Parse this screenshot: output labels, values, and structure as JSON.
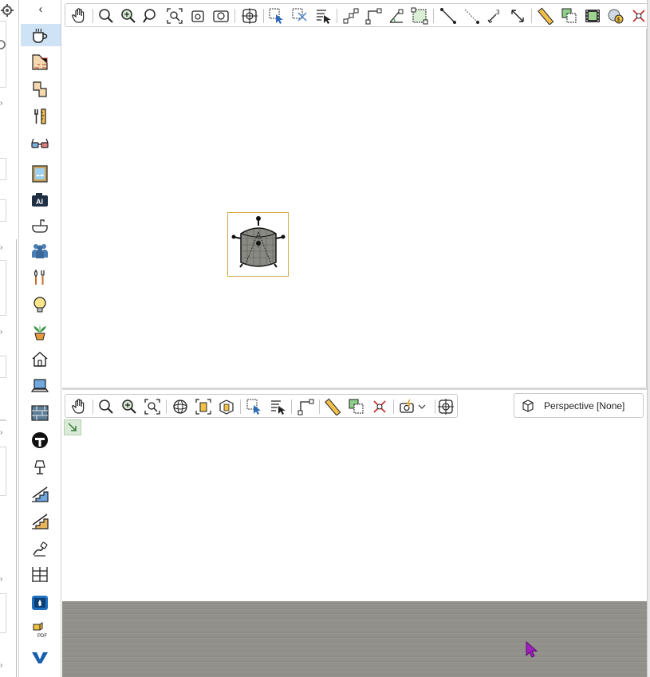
{
  "colors": {
    "selection_highlight": "#cfe3f6",
    "object_selection_border": "#d4a94a",
    "floor": "#918f8a",
    "cursor": "#a020c0"
  },
  "left_panel": {
    "icons": [
      "gear-icon",
      "collapse-arrow-icon"
    ]
  },
  "category_toolbar": {
    "collapse_icon": "chevron-left-icon",
    "collapse_glyph": "‹",
    "items": [
      {
        "name": "kitchen-appliances",
        "icon": "cup-icon"
      },
      {
        "name": "walls",
        "icon": "wall-icon"
      },
      {
        "name": "rooms",
        "icon": "room-icon"
      },
      {
        "name": "tools",
        "icon": "wrench-icon"
      },
      {
        "name": "3d-view",
        "icon": "glasses-icon"
      },
      {
        "name": "pictures",
        "icon": "picture-icon"
      },
      {
        "name": "ai-camera",
        "icon": "ai-camera-icon"
      },
      {
        "name": "bathroom",
        "icon": "sink-icon"
      },
      {
        "name": "people",
        "icon": "people-icon"
      },
      {
        "name": "kitchen-utensils",
        "icon": "utensils-icon"
      },
      {
        "name": "lighting",
        "icon": "light-bulb-icon"
      },
      {
        "name": "plants",
        "icon": "plant-icon"
      },
      {
        "name": "house",
        "icon": "house-icon"
      },
      {
        "name": "computers",
        "icon": "laptop-icon"
      },
      {
        "name": "materials",
        "icon": "texture-icon"
      },
      {
        "name": "brand",
        "icon": "brand-logo-icon"
      },
      {
        "name": "lamps",
        "icon": "lamp-icon"
      },
      {
        "name": "stairs-blue",
        "icon": "stairs-icon"
      },
      {
        "name": "stairs-wood",
        "icon": "stairs-wood-icon"
      },
      {
        "name": "electrical",
        "icon": "plug-icon"
      },
      {
        "name": "shelving",
        "icon": "shelf-icon"
      },
      {
        "name": "fireplace",
        "icon": "fireplace-icon"
      },
      {
        "name": "pdf-import",
        "icon": "pdf-icon"
      },
      {
        "name": "vectorworks",
        "icon": "v-logo-icon"
      }
    ],
    "pdf_label": "PDF"
  },
  "top_toolbar": {
    "buttons": [
      "pan-icon",
      "zoom-icon",
      "zoom-in-icon",
      "zoom-out-icon",
      "zoom-fit-icon",
      "zoom-page-icon",
      "zoom-window-icon",
      "center-icon",
      "select-icon",
      "select-remove-icon",
      "select-properties-icon",
      "snap-points-icon",
      "snap-corner-icon",
      "snap-angle-icon",
      "snap-grid-icon",
      "line-icon",
      "dimension-icon",
      "power-icon",
      "measure-arrow-icon",
      "ruler-icon",
      "copy-icon",
      "film-icon",
      "coin-icon",
      "delete-icon"
    ]
  },
  "view3d_toolbar": {
    "buttons": [
      "pan-icon",
      "zoom-icon",
      "zoom-in-icon",
      "zoom-fit-icon",
      "orbit-icon",
      "walls-icon",
      "box-icon",
      "select-icon",
      "select-properties-icon",
      "snap-corner-icon",
      "ruler-icon",
      "copy-icon",
      "delete-icon",
      "camera-icon",
      "dropdown-icon",
      "center-icon"
    ],
    "perspective_label": "Perspective [None]"
  },
  "plan": {
    "object": "pot-icon"
  }
}
